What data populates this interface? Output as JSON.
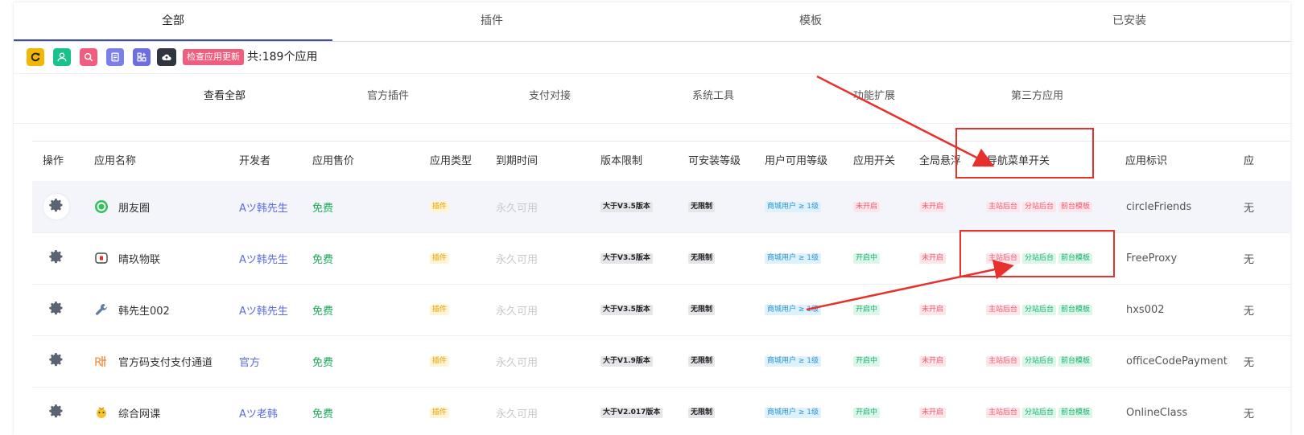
{
  "tabs": [
    "全部",
    "插件",
    "模板",
    "已安装"
  ],
  "toolbar": {
    "check_update_label": "检查应用更新",
    "total_label": "共:189个应用",
    "colors": [
      "#f2b700",
      "#19c28a",
      "#f25c7e",
      "#7b7fe8",
      "#6d6fe0",
      "#303540"
    ]
  },
  "categories": [
    "查看全部",
    "官方插件",
    "支付对接",
    "系统工具",
    "功能扩展",
    "第三方应用"
  ],
  "table": {
    "headers": [
      "操作",
      "应用名称",
      "开发者",
      "应用售价",
      "应用类型",
      "到期时间",
      "版本限制",
      "可安装等级",
      "用户可用等级",
      "应用开关",
      "全局悬浮",
      "导航菜单开关",
      "应用标识",
      "应"
    ],
    "rows": [
      {
        "name": "朋友圈",
        "developer": "Aツ韩先生",
        "price": "免费",
        "type": "插件",
        "expire": "永久可用",
        "version": "大于V3.5版本",
        "level": "无限制",
        "user_level": "商城用户 ≥ 1级",
        "switch": "未开启",
        "float": "未开启",
        "nav": [
          "主站后台",
          "分站后台",
          "前台模板"
        ],
        "ident": "circleFriends",
        "extra": "无",
        "icon": "circle-icon"
      },
      {
        "name": "晴玖物联",
        "developer": "Aツ韩先生",
        "price": "免费",
        "type": "插件",
        "expire": "永久可用",
        "version": "大于V3.5版本",
        "level": "无限制",
        "user_level": "商城用户 ≥ 1级",
        "switch": "开启中",
        "float": "未开启",
        "nav": [
          "主站后台",
          "分站后台",
          "前台模板"
        ],
        "ident": "FreeProxy",
        "extra": "无",
        "icon": "device-icon"
      },
      {
        "name": "韩先生002",
        "developer": "Aツ韩先生",
        "price": "免费",
        "type": "插件",
        "expire": "永久可用",
        "version": "大于V3.5版本",
        "level": "无限制",
        "user_level": "商城用户 ≥ 1级",
        "switch": "开启中",
        "float": "未开启",
        "nav": [
          "主站后台",
          "分站后台",
          "前台模板"
        ],
        "ident": "hxs002",
        "extra": "无",
        "icon": "wrench-icon"
      },
      {
        "name": "官方码支付支付通道",
        "developer": "官方",
        "price": "免费",
        "type": "插件",
        "expire": "永久可用",
        "version": "大于V1.9版本",
        "level": "无限制",
        "user_level": "商城用户 ≥ 1级",
        "switch": "开启中",
        "float": "未开启",
        "nav": [
          "主站后台",
          "分站后台",
          "前台模板"
        ],
        "ident": "officeCodePayment",
        "extra": "无",
        "icon": "pay-icon"
      },
      {
        "name": "综合网课",
        "developer": "Aツ老韩",
        "price": "免费",
        "type": "插件",
        "expire": "永久可用",
        "version": "大于V2.017版本",
        "level": "无限制",
        "user_level": "商城用户 ≥ 1级",
        "switch": "开启中",
        "float": "未开启",
        "nav": [
          "主站后台",
          "分站后台",
          "前台模板"
        ],
        "ident": "OnlineClass",
        "extra": "无",
        "icon": "class-icon"
      }
    ]
  }
}
